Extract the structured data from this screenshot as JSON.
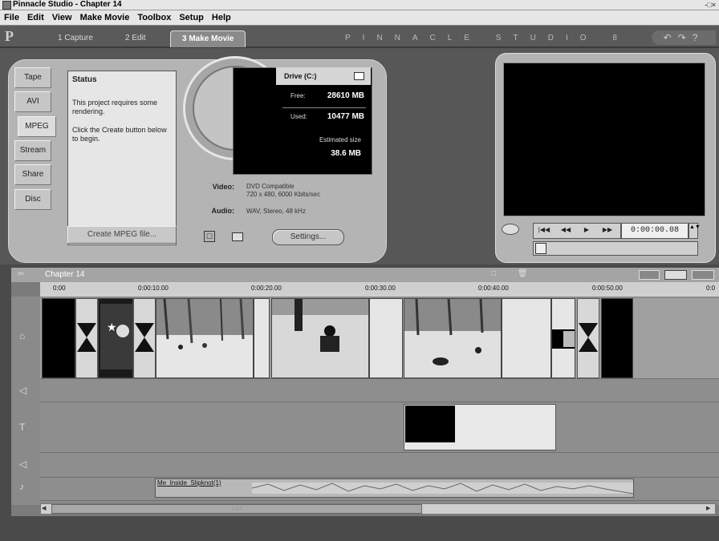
{
  "window": {
    "title": "Pinnacle Studio - Chapter 14",
    "controls": "-□×"
  },
  "menu": [
    "File",
    "Edit",
    "View",
    "Make Movie",
    "Toolbox",
    "Setup",
    "Help"
  ],
  "appbar": {
    "logo": "P",
    "tabs": [
      {
        "label": "1 Capture"
      },
      {
        "label": "2 Edit"
      },
      {
        "label": "3 Make Movie"
      }
    ],
    "brand": "PINNACLE STUDIO 8",
    "help_icons": "?"
  },
  "make_movie": {
    "side_tabs": [
      "Tape",
      "AVI",
      "MPEG",
      "Stream",
      "Share",
      "Disc"
    ],
    "active_tab": "MPEG",
    "status": {
      "heading": "Status",
      "line1": "This project requires some rendering.",
      "line2": "Click the Create button below to begin."
    },
    "create_button": "Create MPEG file...",
    "drive": {
      "label": "Drive (C:)",
      "free_label": "Free:",
      "free_value": "28610 MB",
      "used_label": "Used:",
      "used_value": "10477 MB",
      "used_fraction": 0.27,
      "estimated_label": "Estimated size",
      "estimated_value": "38.6 MB"
    },
    "video_label": "Video:",
    "video_value_1": "DVD Compatible",
    "video_value_2": "720 x 480, 6000 Kbits/sec",
    "audio_label": "Audio:",
    "audio_value": "WAV, Stereo, 48 kHz",
    "settings_button": "Settings...",
    "disc_icon_glyph": "☐"
  },
  "player": {
    "buttons": [
      "|◀◀",
      "◀◀",
      "▶",
      "▶▶"
    ],
    "timecode": "0:00:00.08",
    "spin": "▲▼"
  },
  "timeline": {
    "chapter": "Chapter 14",
    "ruler": [
      "0:00",
      "0:00:10.00",
      "0:00:20.00",
      "0:00:30.00",
      "0:00:40.00",
      "0:00:50.00",
      "0:0"
    ],
    "music_title": "Me_Inside_Slipknot(1)",
    "head_icons": "□ 🗑"
  }
}
